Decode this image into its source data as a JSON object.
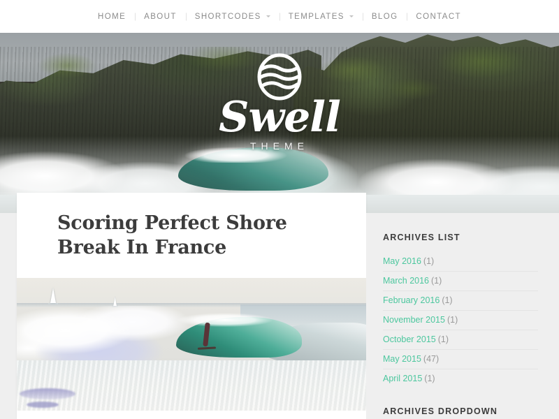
{
  "nav": {
    "items": [
      {
        "label": "HOME",
        "has_dropdown": false
      },
      {
        "label": "ABOUT",
        "has_dropdown": false
      },
      {
        "label": "SHORTCODES",
        "has_dropdown": true
      },
      {
        "label": "TEMPLATES",
        "has_dropdown": true
      },
      {
        "label": "BLOG",
        "has_dropdown": false
      },
      {
        "label": "CONTACT",
        "has_dropdown": false
      }
    ]
  },
  "hero": {
    "logo_word": "Swell",
    "logo_sub": "THEME",
    "logo_mark_name": "wave-circle-emblem",
    "image_alt": "rocky-sea-cliff-with-breaking-wave"
  },
  "post": {
    "title": "Scoring Perfect Shore Break In France",
    "featured_image_alt": "surfer-riding-teal-wave"
  },
  "sidebar": {
    "archives_list": {
      "title": "ARCHIVES LIST",
      "items": [
        {
          "label": "May 2016",
          "count": "(1)"
        },
        {
          "label": "March 2016",
          "count": "(1)"
        },
        {
          "label": "February 2016",
          "count": "(1)"
        },
        {
          "label": "November 2015",
          "count": "(1)"
        },
        {
          "label": "October 2015",
          "count": "(1)"
        },
        {
          "label": "May 2015",
          "count": "(47)"
        },
        {
          "label": "April 2015",
          "count": "(1)"
        }
      ]
    },
    "archives_dropdown": {
      "title": "ARCHIVES DROPDOWN"
    }
  },
  "colors": {
    "link": "#4cc79e",
    "nav_text": "#8b8b8b",
    "heading": "#3c3c3c",
    "page_bg": "#efefef",
    "card_bg": "#ffffff"
  }
}
